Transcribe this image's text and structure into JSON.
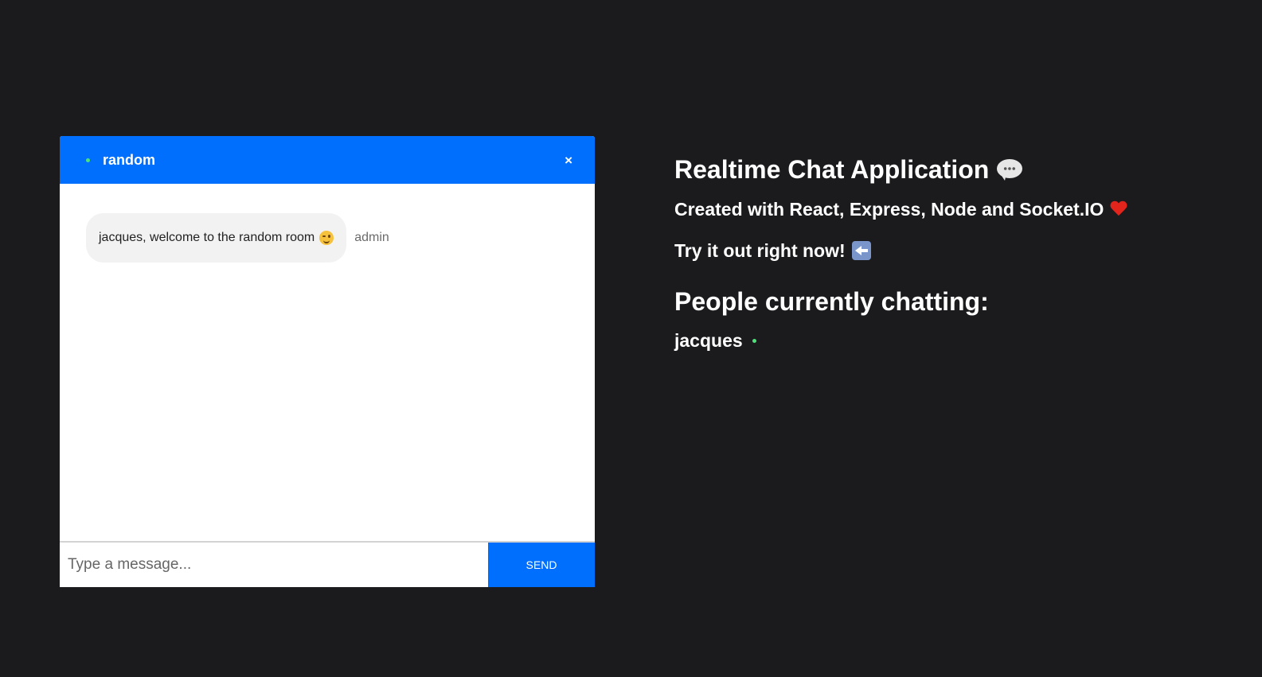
{
  "chat": {
    "room_name": "random",
    "close_label": "×",
    "messages": [
      {
        "text": "jacques, welcome to the random room",
        "emoji": "winking-face-icon",
        "sender": "admin"
      }
    ],
    "input_placeholder": "Type a message...",
    "input_value": "",
    "send_label": "SEND"
  },
  "info": {
    "title": "Realtime Chat Application",
    "title_icon": "speech-balloon-icon",
    "subtitle": "Created with React, Express, Node and Socket.IO",
    "subtitle_icon": "heart-icon",
    "cta": "Try it out right now!",
    "cta_icon": "left-arrow-icon",
    "people_heading": "People currently chatting:",
    "people": [
      {
        "name": "jacques",
        "status": "online"
      }
    ]
  },
  "colors": {
    "background": "#1b1b1e",
    "accent": "#016ffe",
    "online": "#4ee37a",
    "bubble": "#f2f2f2"
  }
}
